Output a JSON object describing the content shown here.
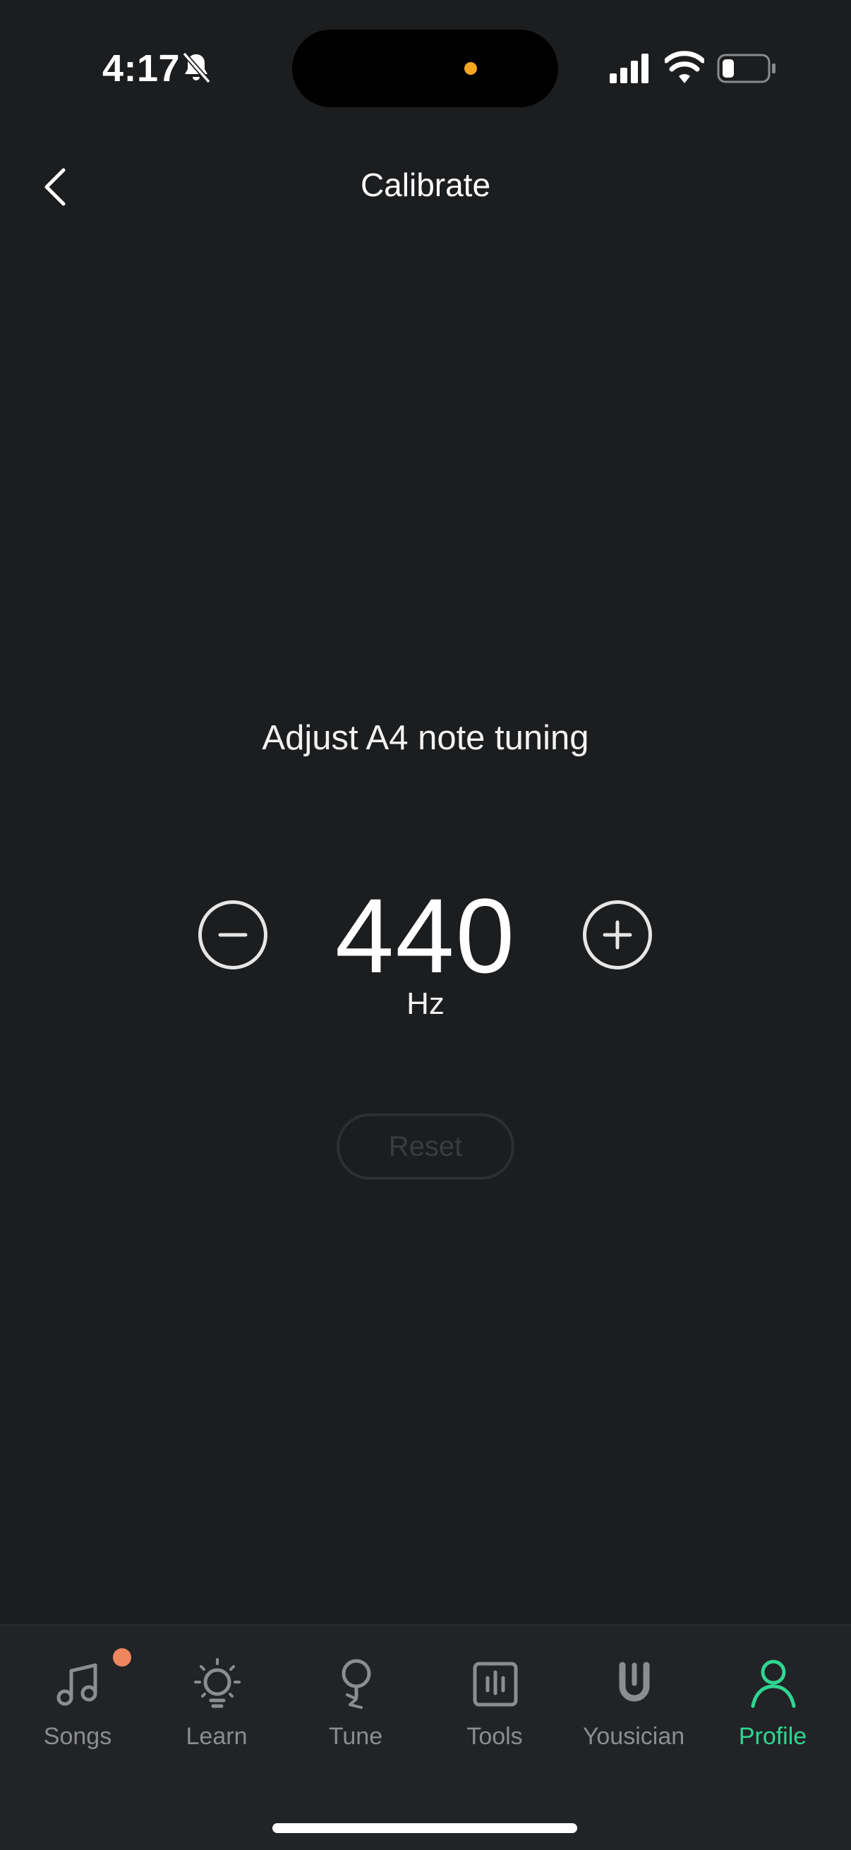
{
  "status_bar": {
    "time": "4:17",
    "icons": [
      "bell-slash-icon",
      "signal-icon",
      "wifi-icon",
      "battery-icon"
    ],
    "battery_level": 0.2,
    "island_dot_color": "#f5a623"
  },
  "header": {
    "title": "Calibrate",
    "back_icon": "chevron-left-icon"
  },
  "main": {
    "prompt": "Adjust A4 note tuning",
    "frequency": "440",
    "unit": "Hz",
    "minus_icon": "minus-circle-icon",
    "plus_icon": "plus-circle-icon",
    "reset_label": "Reset"
  },
  "tab_bar": {
    "active": "Profile",
    "accent_color": "#2fd691",
    "notification_color": "#f0865f",
    "items": [
      {
        "label": "Songs",
        "icon": "music-note-icon",
        "badge": true
      },
      {
        "label": "Learn",
        "icon": "lightbulb-icon"
      },
      {
        "label": "Tune",
        "icon": "tuner-icon"
      },
      {
        "label": "Tools",
        "icon": "tools-icon"
      },
      {
        "label": "Yousician",
        "icon": "yousician-logo-icon"
      },
      {
        "label": "Profile",
        "icon": "person-icon"
      }
    ]
  },
  "colors": {
    "background": "#1c1d1f",
    "tab_bar_background": "#222326"
  }
}
